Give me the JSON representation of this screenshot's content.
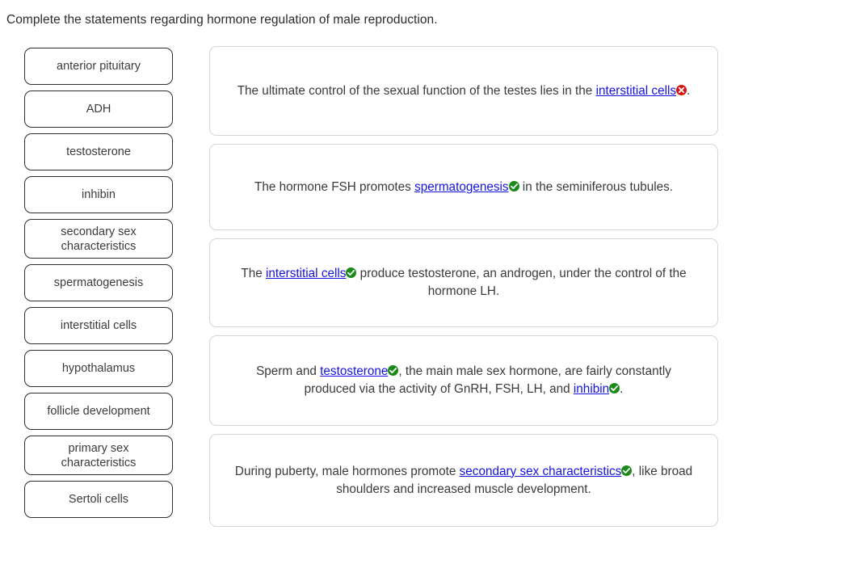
{
  "prompt": "Complete the statements regarding hormone regulation of male reproduction.",
  "colors": {
    "link": "#1414dd",
    "correct": "#1a8a18",
    "incorrect": "#d81111",
    "text": "#3a3a3a",
    "bank_border": "#2f2f2f",
    "card_border": "#d6d6d6"
  },
  "word_bank": {
    "items": [
      {
        "label": "anterior pituitary",
        "lines": 1
      },
      {
        "label": "ADH",
        "lines": 1
      },
      {
        "label": "testosterone",
        "lines": 1
      },
      {
        "label": "inhibin",
        "lines": 1
      },
      {
        "label": "secondary sex characteristics",
        "lines": 2
      },
      {
        "label": "spermatogenesis",
        "lines": 1
      },
      {
        "label": "interstitial cells",
        "lines": 1
      },
      {
        "label": "hypothalamus",
        "lines": 1
      },
      {
        "label": "follicle development",
        "lines": 1
      },
      {
        "label": "primary sex characteristics",
        "lines": 2
      },
      {
        "label": "Sertoli cells",
        "lines": 1
      }
    ]
  },
  "statements": [
    {
      "id": 1,
      "before": "The ultimate control of the sexual function of the testes lies in the ",
      "answer": "interstitial cells",
      "status": "incorrect",
      "status_icon": "red-x-circle-icon",
      "after": "."
    },
    {
      "id": 2,
      "before": "The hormone FSH promotes ",
      "answer": "spermatogenesis",
      "status": "correct",
      "status_icon": "green-check-circle-icon",
      "after": " in the seminiferous tubules."
    },
    {
      "id": 3,
      "before": "The ",
      "answer": "interstitial cells",
      "status": "correct",
      "status_icon": "green-check-circle-icon",
      "after": " produce testosterone, an androgen, under the control of the hormone LH."
    },
    {
      "id": 4,
      "before": "Sperm and ",
      "answer": "testosterone",
      "status": "correct",
      "status_icon": "green-check-circle-icon",
      "middle": ", the main male sex hormone, are fairly constantly produced via the activity of GnRH, FSH, LH, and ",
      "answer2": "inhibin",
      "status2": "correct",
      "status2_icon": "green-check-circle-icon",
      "after": "."
    },
    {
      "id": 5,
      "before": "During puberty, male hormones promote ",
      "answer": "secondary sex characteristics",
      "status": "correct",
      "status_icon": "green-check-circle-icon",
      "after": ", like broad shoulders and increased muscle development."
    }
  ]
}
